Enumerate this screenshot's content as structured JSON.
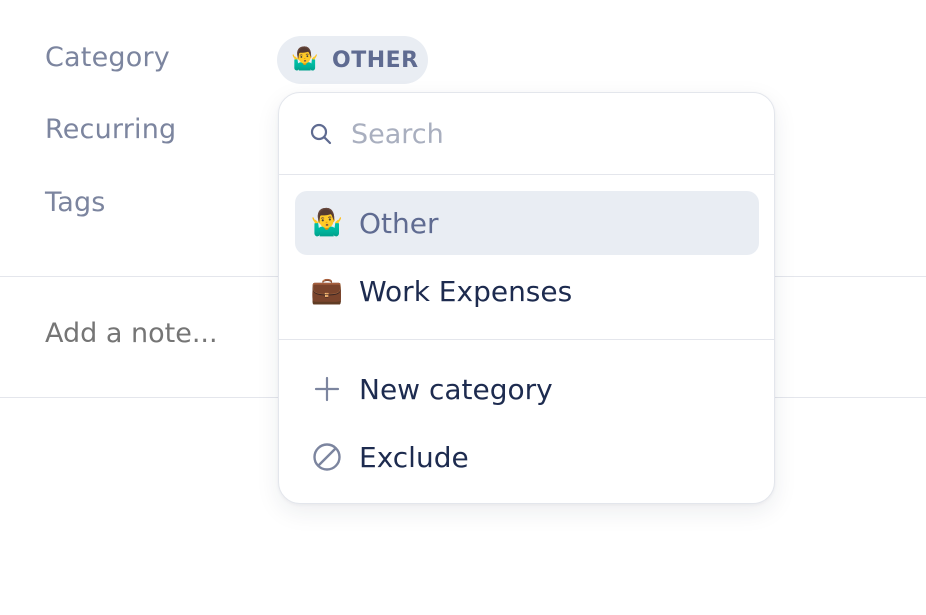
{
  "form": {
    "category_label": "Category",
    "recurring_label": "Recurring",
    "tags_label": "Tags",
    "note_placeholder": "Add a note..."
  },
  "category_pill": {
    "icon": "person-shrugging-emoji",
    "emoji": "🤷‍♂️",
    "text": "OTHER"
  },
  "dropdown": {
    "search_placeholder": "Search",
    "search_value": "",
    "categories": [
      {
        "emoji": "🤷‍♂️",
        "icon": "person-shrugging-emoji",
        "label": "Other",
        "selected": true
      },
      {
        "emoji": "💼",
        "icon": "briefcase-emoji",
        "label": "Work Expenses",
        "selected": false
      }
    ],
    "actions": [
      {
        "icon": "plus-icon",
        "label": "New category"
      },
      {
        "icon": "prohibited-icon",
        "label": "Exclude"
      }
    ]
  },
  "colors": {
    "label": "#7c859f",
    "pill_bg": "#e9edf3",
    "pill_text": "#5f6b91",
    "item_text": "#1d2b4f",
    "placeholder": "#a9afbf",
    "divider": "#e4e6ec"
  }
}
